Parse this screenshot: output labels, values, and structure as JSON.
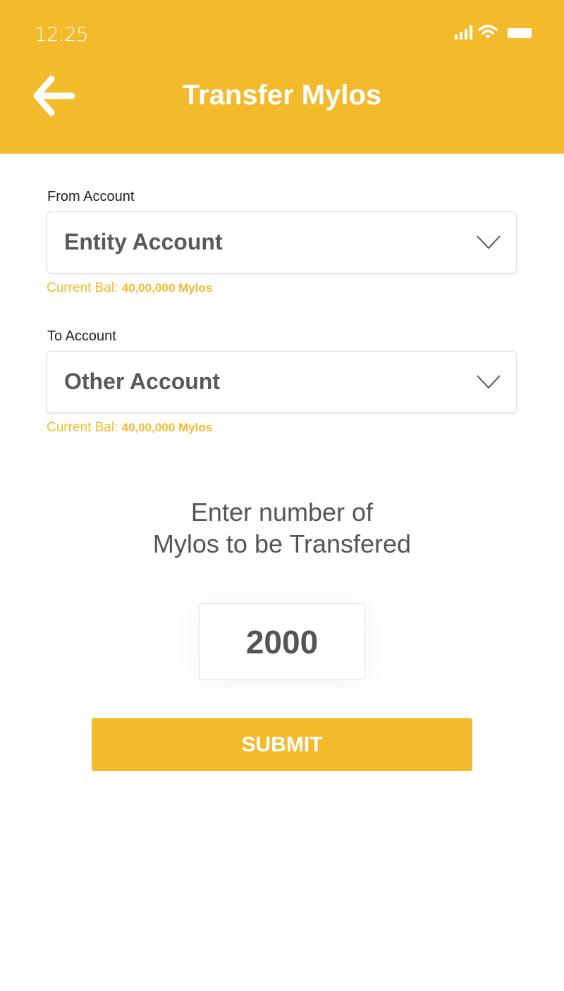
{
  "status_bar": {
    "time": "12:25"
  },
  "header": {
    "title": "Transfer Mylos"
  },
  "from": {
    "label": "From Account",
    "value": "Entity Account",
    "bal_label": "Current Bal:",
    "bal_value": "40,00,000 Mylos"
  },
  "to": {
    "label": "To Account",
    "value": "Other Account",
    "bal_label": "Current Bal:",
    "bal_value": "40,00,000 Mylos"
  },
  "prompt": {
    "line1": "Enter number of",
    "line2": "Mylos to be Transfered"
  },
  "amount": "2000",
  "submit_label": "SUBMIT",
  "colors": {
    "accent": "#F3BB2B"
  }
}
